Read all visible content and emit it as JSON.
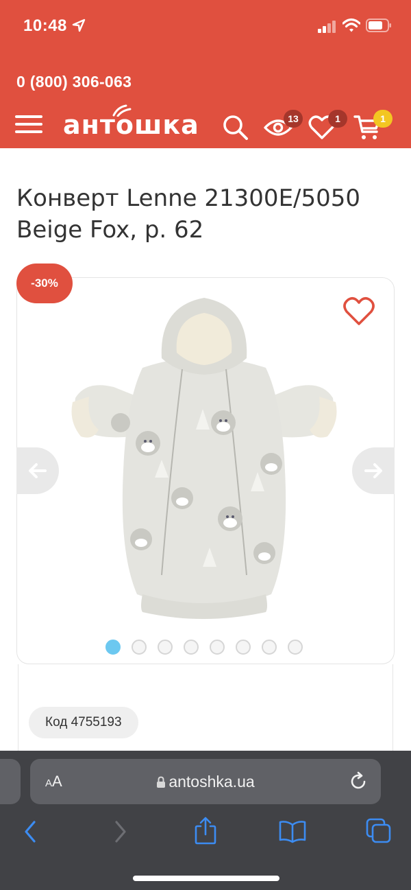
{
  "status_bar": {
    "time": "10:48"
  },
  "header": {
    "phone": "0 (800) 306-063",
    "logo_text": "антошка",
    "viewed_count": "13",
    "wishlist_count": "1",
    "cart_count": "1"
  },
  "product": {
    "title": "Конверт Lenne 21300E/5050 Beige Fox, р. 62",
    "discount_badge": "-30%",
    "code_label": "Код 4755193",
    "gallery": {
      "image_count": 8,
      "active_index": 0
    }
  },
  "browser": {
    "text_size_label_small": "A",
    "text_size_label_big": "A",
    "url": "antoshka.ua"
  },
  "colors": {
    "brand_red": "#e0503f",
    "badge_dark": "#a5362b",
    "badge_yellow": "#f3c622",
    "dot_active": "#6cc8f0",
    "safari_bg": "#414246",
    "safari_blue": "#3c8cf2"
  },
  "icons": {
    "menu": "hamburger-icon",
    "search": "search-icon",
    "viewed": "eye-icon",
    "wishlist": "heart-icon",
    "cart": "cart-icon",
    "favorite": "heart-outline-icon",
    "prev": "arrow-left-icon",
    "next": "arrow-right-icon",
    "back": "chevron-left-icon",
    "forward": "chevron-right-icon",
    "share": "share-icon",
    "bookmarks": "book-icon",
    "tabs": "tabs-icon",
    "reload": "reload-icon",
    "lock": "lock-icon"
  }
}
